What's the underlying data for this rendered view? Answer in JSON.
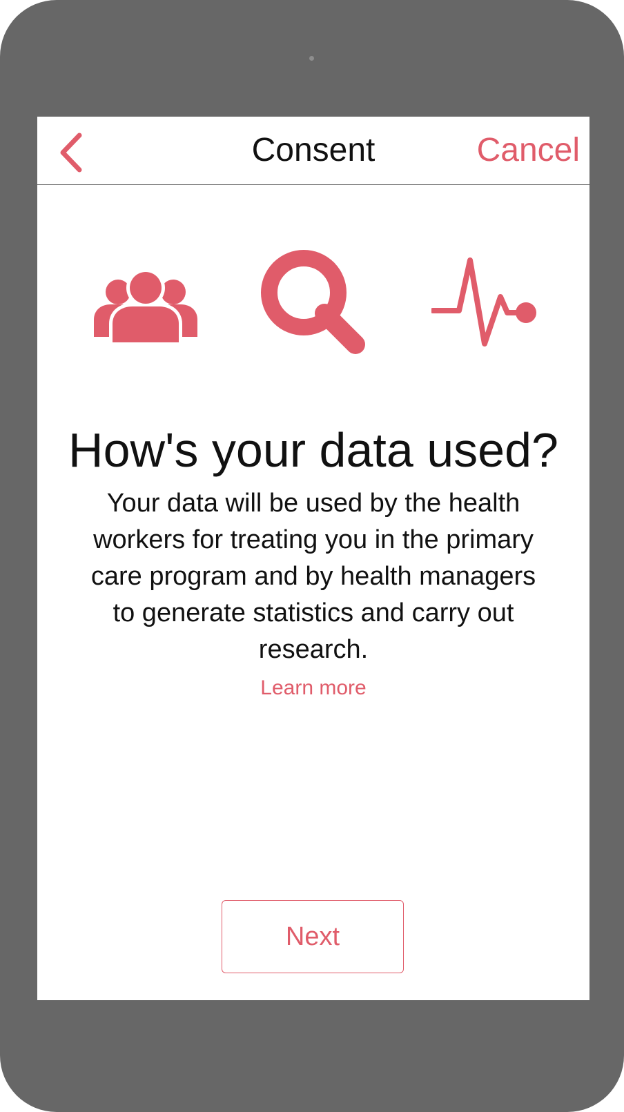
{
  "nav": {
    "title": "Consent",
    "cancel_label": "Cancel",
    "back_icon": "chevron-left-icon"
  },
  "icons": [
    {
      "name": "people-icon"
    },
    {
      "name": "search-icon"
    },
    {
      "name": "pulse-icon"
    }
  ],
  "content": {
    "headline": "How's your data used?",
    "body": "Your data will be used by the health workers for treating you in the primary care program and by health managers to generate statistics and carry out research.",
    "learn_more_label": "Learn more"
  },
  "footer": {
    "next_label": "Next"
  },
  "colors": {
    "accent": "#e05c6a",
    "device_frame": "#676767",
    "screen_background": "#ffffff",
    "text": "#111111"
  }
}
